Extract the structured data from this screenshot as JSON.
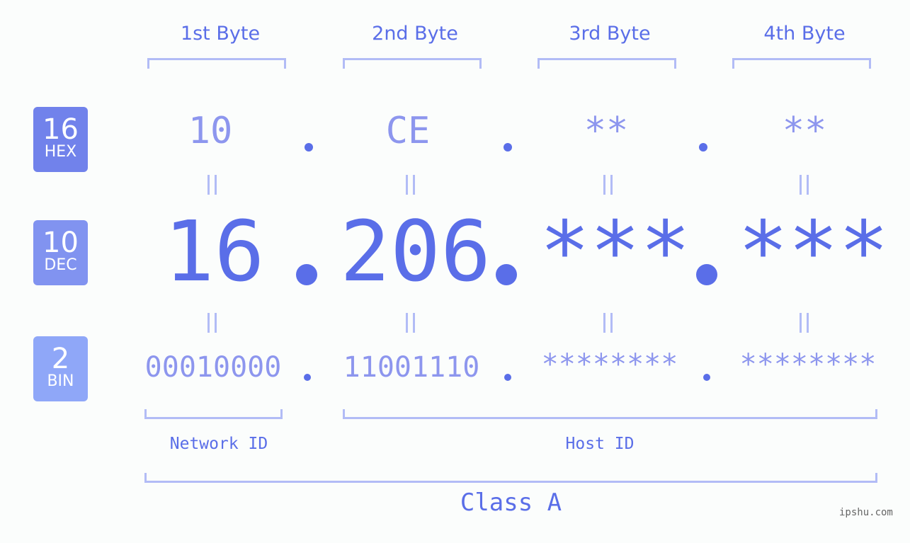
{
  "bytes": [
    {
      "label": "1st Byte",
      "hex": "10",
      "dec": "16",
      "bin": "00010000"
    },
    {
      "label": "2nd Byte",
      "hex": "CE",
      "dec": "206",
      "bin": "11001110"
    },
    {
      "label": "3rd Byte",
      "hex": "**",
      "dec": "***",
      "bin": "********"
    },
    {
      "label": "4th Byte",
      "hex": "**",
      "dec": "***",
      "bin": "********"
    }
  ],
  "badges": {
    "hex": {
      "num": "16",
      "label": "HEX",
      "color": "#7182eb"
    },
    "dec": {
      "num": "10",
      "label": "DEC",
      "color": "#8193f0"
    },
    "bin": {
      "num": "2",
      "label": "BIN",
      "color": "#8fa7f8"
    }
  },
  "network_id_label": "Network ID",
  "host_id_label": "Host ID",
  "class_label": "Class A",
  "watermark": "ipshu.com",
  "colors": {
    "primary": "#5a6ee8",
    "light": "#8d96ee",
    "bracket": "#b2bcf6"
  }
}
